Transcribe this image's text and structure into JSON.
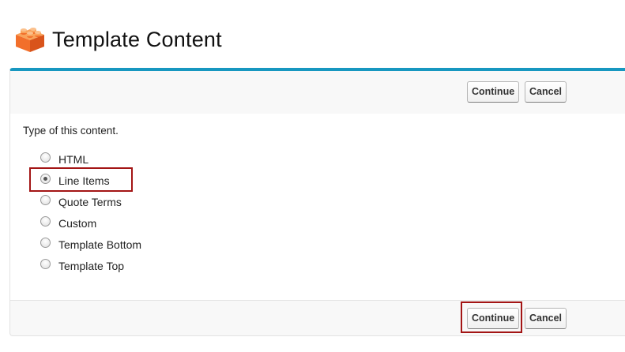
{
  "header": {
    "title": "Template Content",
    "icon": "brick-icon",
    "icon_color": "#f26f2b"
  },
  "top_bar": {
    "continue_label": "Continue",
    "cancel_label": "Cancel"
  },
  "content": {
    "instruction": "Type of this content.",
    "options": [
      {
        "label": "HTML",
        "selected": false
      },
      {
        "label": "Line Items",
        "selected": true
      },
      {
        "label": "Quote Terms",
        "selected": false
      },
      {
        "label": "Custom",
        "selected": false
      },
      {
        "label": "Template Bottom",
        "selected": false
      },
      {
        "label": "Template Top",
        "selected": false
      }
    ]
  },
  "bottom_bar": {
    "continue_label": "Continue",
    "cancel_label": "Cancel"
  },
  "colors": {
    "accent": "#1797c0",
    "highlight": "#a31515"
  }
}
